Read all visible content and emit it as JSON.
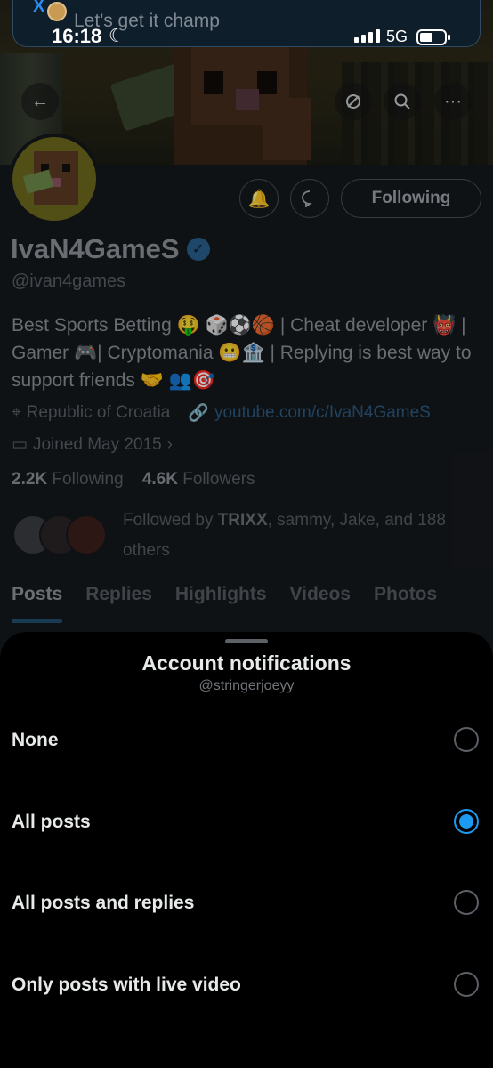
{
  "notification": {
    "toast_text": "Let's get it champ"
  },
  "status_bar": {
    "time": "16:18",
    "network": "5G"
  },
  "nav": {
    "back_icon": "arrow-left-icon",
    "icons": [
      "mute-icon",
      "search-icon",
      "more-icon"
    ]
  },
  "profile": {
    "display_name": "IvaN4GameS",
    "handle": "@ivan4games",
    "bio": "Best Sports Betting 🤑 🎲⚽🏀 | Cheat developer 👹 | Gamer 🎮| Cryptomania 😬🏦 | Replying is best way to support friends 🤝 👥🎯",
    "location": "Republic of Croatia",
    "website": "youtube.com/c/IvaN4GameS",
    "joined": "Joined May 2015",
    "following_count": "2.2K",
    "following_label": "Following",
    "followers_count": "4.6K",
    "followers_label": "Followers",
    "followed_by_prefix": "Followed by ",
    "followed_by_bold": "TRIXX",
    "followed_by_rest": ", sammy, Jake, and 188 others",
    "following_button": "Following"
  },
  "tabs": [
    {
      "label": "Posts",
      "active": true
    },
    {
      "label": "Replies",
      "active": false
    },
    {
      "label": "Highlights",
      "active": false
    },
    {
      "label": "Videos",
      "active": false
    },
    {
      "label": "Photos",
      "active": false
    }
  ],
  "sheet": {
    "title": "Account notifications",
    "subtitle": "@stringerjoeyy",
    "options": [
      {
        "label": "None",
        "selected": false
      },
      {
        "label": "All posts",
        "selected": true
      },
      {
        "label": "All posts and replies",
        "selected": false
      },
      {
        "label": "Only posts with live video",
        "selected": false
      }
    ]
  },
  "colors": {
    "accent": "#1d9bf0",
    "sheet_bg": "#000000",
    "text_primary": "#e7e9ea",
    "text_secondary": "#71767b"
  }
}
